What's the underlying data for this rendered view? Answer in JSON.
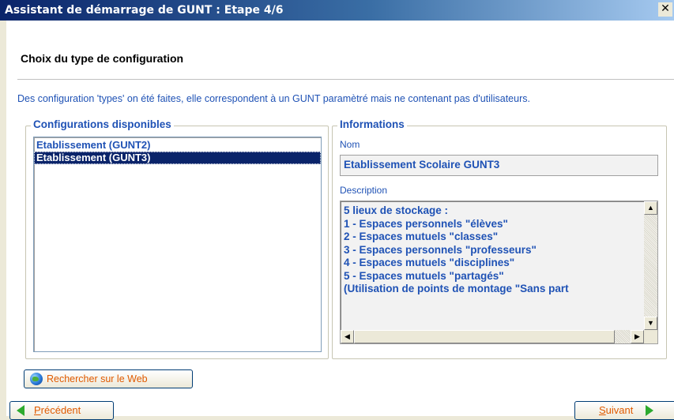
{
  "window": {
    "title": "Assistant de démarrage de GUNT : Etape 4/6",
    "close_glyph": "✕"
  },
  "header": {
    "title": "Choix du type de configuration"
  },
  "intro": "Des configuration 'types' on été faites, elle correspondent à un GUNT paramètré mais ne contenant pas d'utilisateurs.",
  "configurations": {
    "legend": "Configurations disponibles",
    "items": [
      {
        "label": "Etablissement (GUNT2)",
        "selected": false
      },
      {
        "label": "Etablissement (GUNT3)",
        "selected": true
      }
    ]
  },
  "informations": {
    "legend": "Informations",
    "nom_label": "Nom",
    "nom_value": "Etablissement Scolaire GUNT3",
    "description_label": "Description",
    "description_lines": [
      "5 lieux de stockage :",
      "1 - Espaces personnels \"élèves\"",
      "2 - Espaces mutuels \"classes\"",
      "3 - Espaces personnels \"professeurs\"",
      "4 - Espaces mutuels \"disciplines\"",
      "5 - Espaces mutuels \"partagés\"",
      "(Utilisation de points de montage \"Sans part"
    ]
  },
  "buttons": {
    "web": "Rechercher sur le Web",
    "prev_first": "P",
    "prev_rest": "récédent",
    "next_first": "S",
    "next_rest": "uivant"
  },
  "icons": {
    "web": "globe-icon",
    "prev": "arrow-left-icon",
    "next": "arrow-right-icon"
  },
  "colors": {
    "accent_text": "#1f52b5",
    "selection": "#0a246a",
    "button_text": "#e05a00",
    "arrow": "#2eaa2e"
  }
}
